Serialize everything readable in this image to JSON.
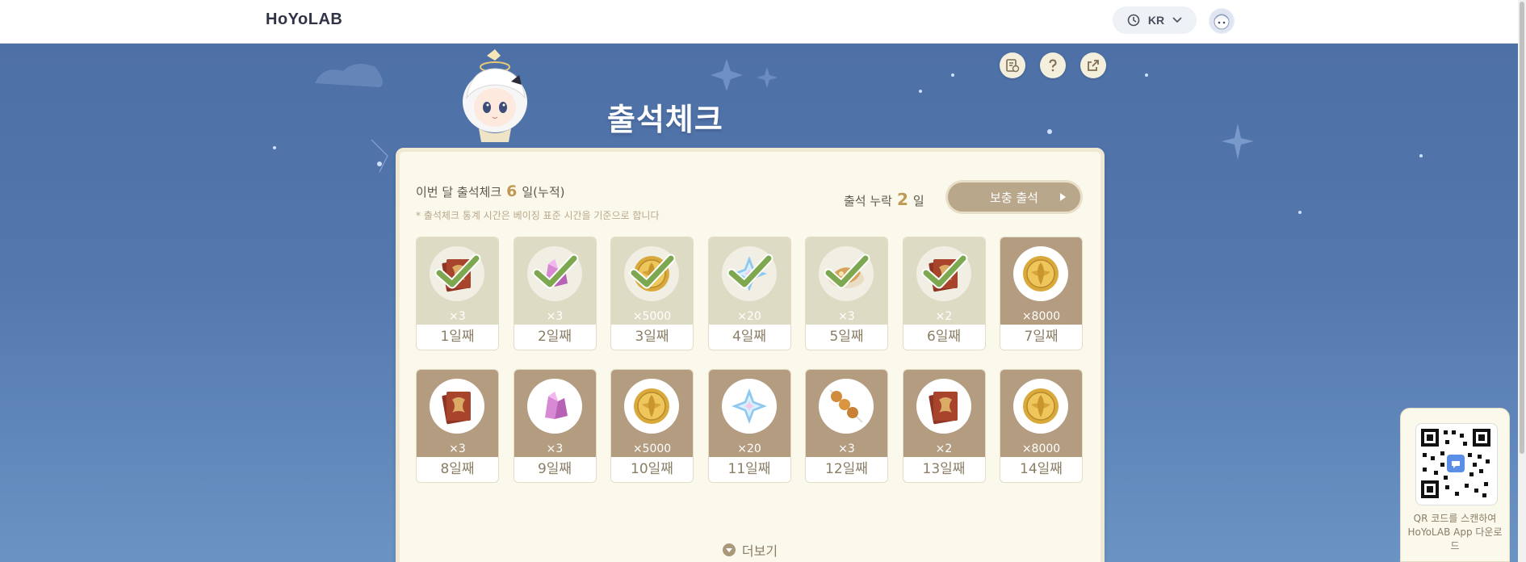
{
  "header": {
    "logo": "HoYoLAB",
    "region_label": "KR"
  },
  "page": {
    "title": "출석체크",
    "summary_prefix": "이번 달 출석체크",
    "summary_days": "6",
    "summary_suffix": "일(누적)",
    "note": "* 출석체크 통계 시간은 베이징 표준 시간을 기준으로 합니다",
    "missed_prefix": "출석 누락",
    "missed_days": "2",
    "missed_suffix": "일",
    "makeup_button": "보충 출석",
    "more_label": "더보기"
  },
  "days": [
    {
      "label": "1일째",
      "qty": "×3",
      "item": "hero-wit-icon",
      "claimed": true
    },
    {
      "label": "2일째",
      "qty": "×3",
      "item": "enhancement-ore-icon",
      "claimed": true
    },
    {
      "label": "3일째",
      "qty": "×5000",
      "item": "mora-icon",
      "claimed": true
    },
    {
      "label": "4일째",
      "qty": "×20",
      "item": "primogem-icon",
      "claimed": true
    },
    {
      "label": "5일째",
      "qty": "×3",
      "item": "food-dish-icon",
      "claimed": true
    },
    {
      "label": "6일째",
      "qty": "×2",
      "item": "hero-wit-icon",
      "claimed": true
    },
    {
      "label": "7일째",
      "qty": "×8000",
      "item": "mora-icon",
      "claimed": false
    },
    {
      "label": "8일째",
      "qty": "×3",
      "item": "hero-wit-icon",
      "claimed": false
    },
    {
      "label": "9일째",
      "qty": "×3",
      "item": "enhancement-ore-icon",
      "claimed": false
    },
    {
      "label": "10일째",
      "qty": "×5000",
      "item": "mora-icon",
      "claimed": false
    },
    {
      "label": "11일째",
      "qty": "×20",
      "item": "primogem-icon",
      "claimed": false
    },
    {
      "label": "12일째",
      "qty": "×3",
      "item": "skewer-food-icon",
      "claimed": false
    },
    {
      "label": "13일째",
      "qty": "×2",
      "item": "hero-wit-icon",
      "claimed": false
    },
    {
      "label": "14일째",
      "qty": "×8000",
      "item": "mora-icon",
      "claimed": false
    }
  ],
  "qr": {
    "text": "QR 코드를 스캔하여 HoYoLAB App 다운로드"
  },
  "colors": {
    "background": "#4b6fa5",
    "card": "#fbf8ec",
    "accent": "#c09a54",
    "reward_bg": "#b39c80",
    "claimed_bg": "#dedbc4",
    "check": "#7da850"
  }
}
